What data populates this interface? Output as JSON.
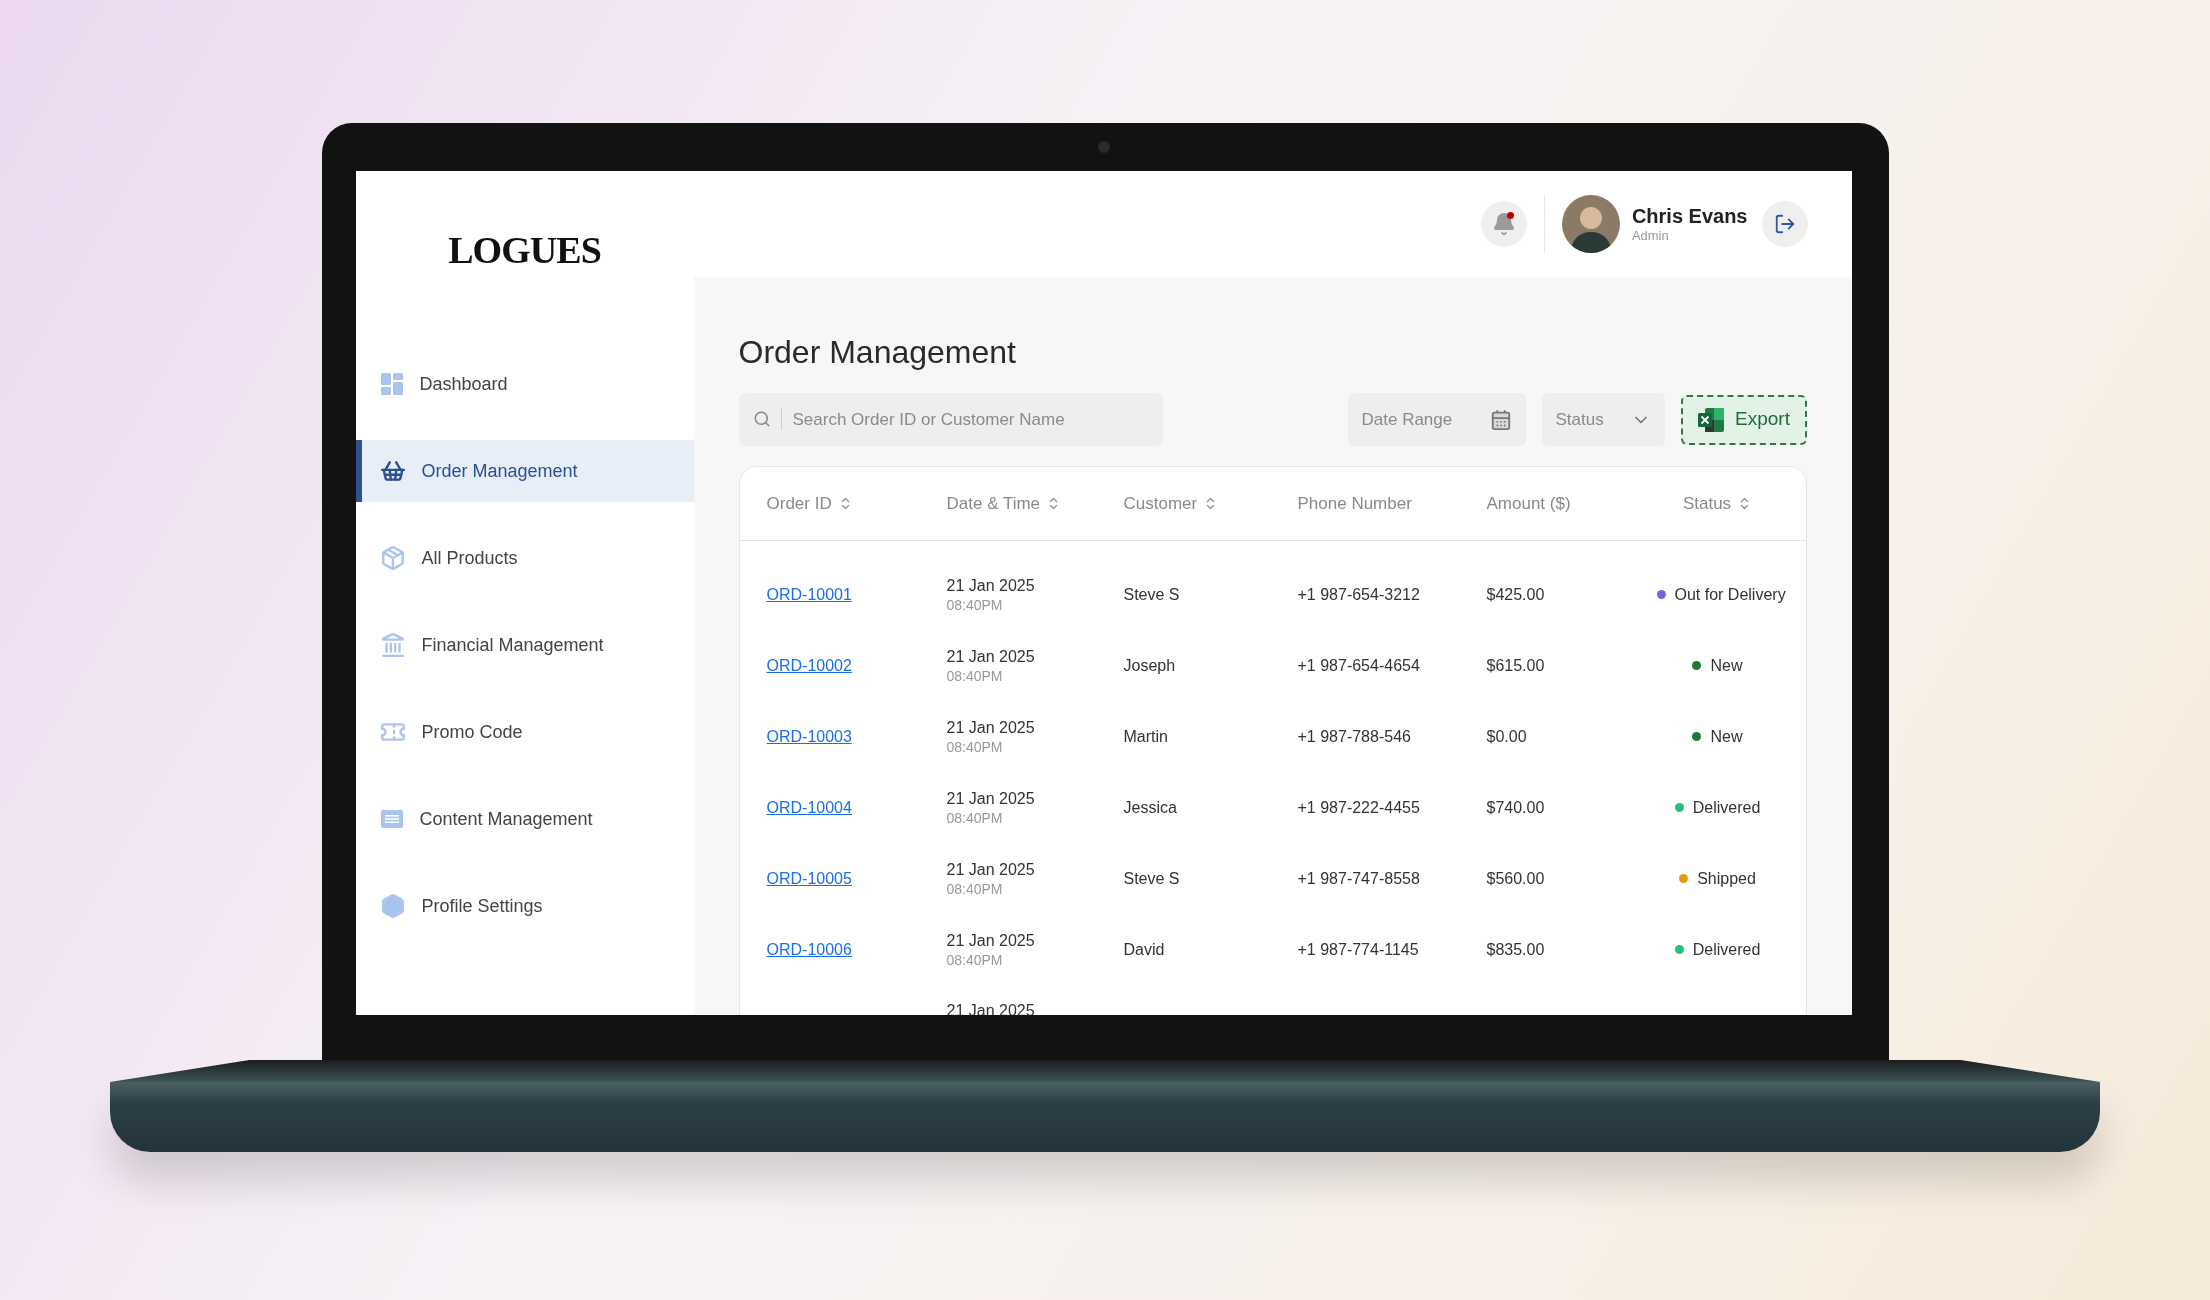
{
  "brand": "LOGUES",
  "header": {
    "notification": {
      "unread": true
    },
    "user": {
      "name": "Chris Evans",
      "role": "Admin"
    }
  },
  "sidebar": {
    "items": [
      {
        "label": "Dashboard",
        "selected": false
      },
      {
        "label": "Order Management",
        "selected": true
      },
      {
        "label": "All Products",
        "selected": false
      },
      {
        "label": "Financial Management",
        "selected": false
      },
      {
        "label": "Promo Code",
        "selected": false
      },
      {
        "label": "Content Management",
        "selected": false
      },
      {
        "label": "Profile Settings",
        "selected": false
      }
    ]
  },
  "page": {
    "title": "Order Management"
  },
  "toolbar": {
    "search": {
      "placeholder": "Search Order ID or Customer Name"
    },
    "date_range": {
      "label": "Date Range"
    },
    "status_filter": {
      "label": "Status"
    },
    "export": {
      "label": "Export"
    }
  },
  "table": {
    "columns": [
      {
        "label": "Order ID",
        "sortable": true
      },
      {
        "label": "Date & Time",
        "sortable": true
      },
      {
        "label": "Customer",
        "sortable": true
      },
      {
        "label": "Phone Number",
        "sortable": false
      },
      {
        "label": "Amount ($)",
        "sortable": false
      },
      {
        "label": "Status",
        "sortable": true
      }
    ],
    "rows": [
      {
        "order_id": "ORD-10001",
        "date": "21 Jan 2025",
        "time": "08:40PM",
        "customer": "Steve S",
        "phone": "+1 987-654-3212",
        "amount": "$425.00",
        "status": "Out for Delivery",
        "color": "#7b61e0"
      },
      {
        "order_id": "ORD-10002",
        "date": "21 Jan 2025",
        "time": "08:40PM",
        "customer": "Joseph",
        "phone": "+1 987-654-4654",
        "amount": "$615.00",
        "status": "New",
        "color": "#1a7a36"
      },
      {
        "order_id": "ORD-10003",
        "date": "21 Jan 2025",
        "time": "08:40PM",
        "customer": "Martin",
        "phone": "+1 987-788-546",
        "amount": "$0.00",
        "status": "New",
        "color": "#1a7a36"
      },
      {
        "order_id": "ORD-10004",
        "date": "21 Jan 2025",
        "time": "08:40PM",
        "customer": "Jessica",
        "phone": "+1 987-222-4455",
        "amount": "$740.00",
        "status": "Delivered",
        "color": "#2ebd7d"
      },
      {
        "order_id": "ORD-10005",
        "date": "21 Jan 2025",
        "time": "08:40PM",
        "customer": "Steve S",
        "phone": "+1 987-747-8558",
        "amount": "$560.00",
        "status": "Shipped",
        "color": "#e8980e"
      },
      {
        "order_id": "ORD-10006",
        "date": "21 Jan 2025",
        "time": "08:40PM",
        "customer": "David",
        "phone": "+1 987-774-1145",
        "amount": "$835.00",
        "status": "Delivered",
        "color": "#2ebd7d"
      }
    ],
    "partial_row": {
      "date": "21 Jan 2025"
    }
  }
}
